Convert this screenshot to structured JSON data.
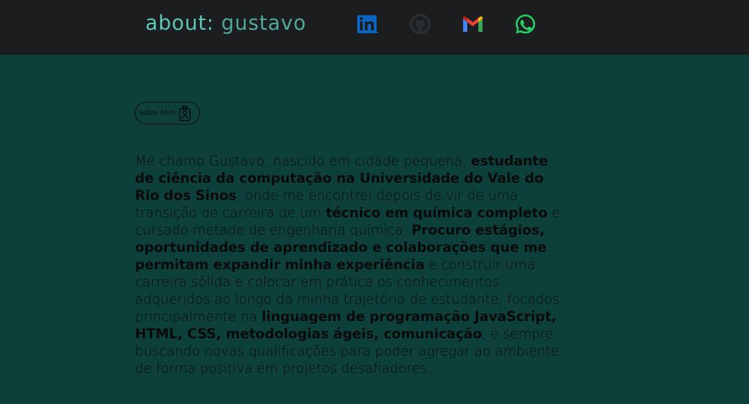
{
  "header": {
    "brand_prefix": "about:",
    "brand_name": " gustavo",
    "social": [
      {
        "name": "linkedin-icon",
        "color": "#0a66c2"
      },
      {
        "name": "github-icon",
        "color": "#2b2e31"
      },
      {
        "name": "gmail-icon",
        "color": "#ea4335"
      },
      {
        "name": "whatsapp-icon",
        "color": "#25d366"
      }
    ]
  },
  "section_badge": {
    "label": "Sobre Mim",
    "icon": "id-badge-icon"
  },
  "bio": {
    "segments": [
      {
        "text": "Me chamo Gustavo, nascido em cidade pequena, ",
        "bold": false
      },
      {
        "text": "estudante de ciência da computação na Universidade do Vale do Rio dos Sinos",
        "bold": true
      },
      {
        "text": ", onde me encontrei depois de vir de uma transição de carreira de um ",
        "bold": false
      },
      {
        "text": "técnico em química completo",
        "bold": true
      },
      {
        "text": " e cursado metade de engenharia química. ",
        "bold": false
      },
      {
        "text": "Procuro estágios, oportunidades de aprendizado e colaborações que me permitam expandir minha experiência",
        "bold": true
      },
      {
        "text": " e construir uma carreira sólida e colocar em prática os conhecimentos adqueridos ao longo da minha trajetória de estudante, focados principalmente na ",
        "bold": false
      },
      {
        "text": "linguagem de programação JavaScript, HTML, CSS, metodologias ágeis, comunicação",
        "bold": true
      },
      {
        "text": ", e sempre buscando novas qualificações para poder agregar ao ambiente de forma positiva em projetos desafiadores.",
        "bold": false
      }
    ]
  },
  "colors": {
    "header_bg": "#1b1d1f",
    "page_bg": "#0d403b",
    "brand_accent": "#5cc8b8",
    "text": "#0a0a0a"
  }
}
